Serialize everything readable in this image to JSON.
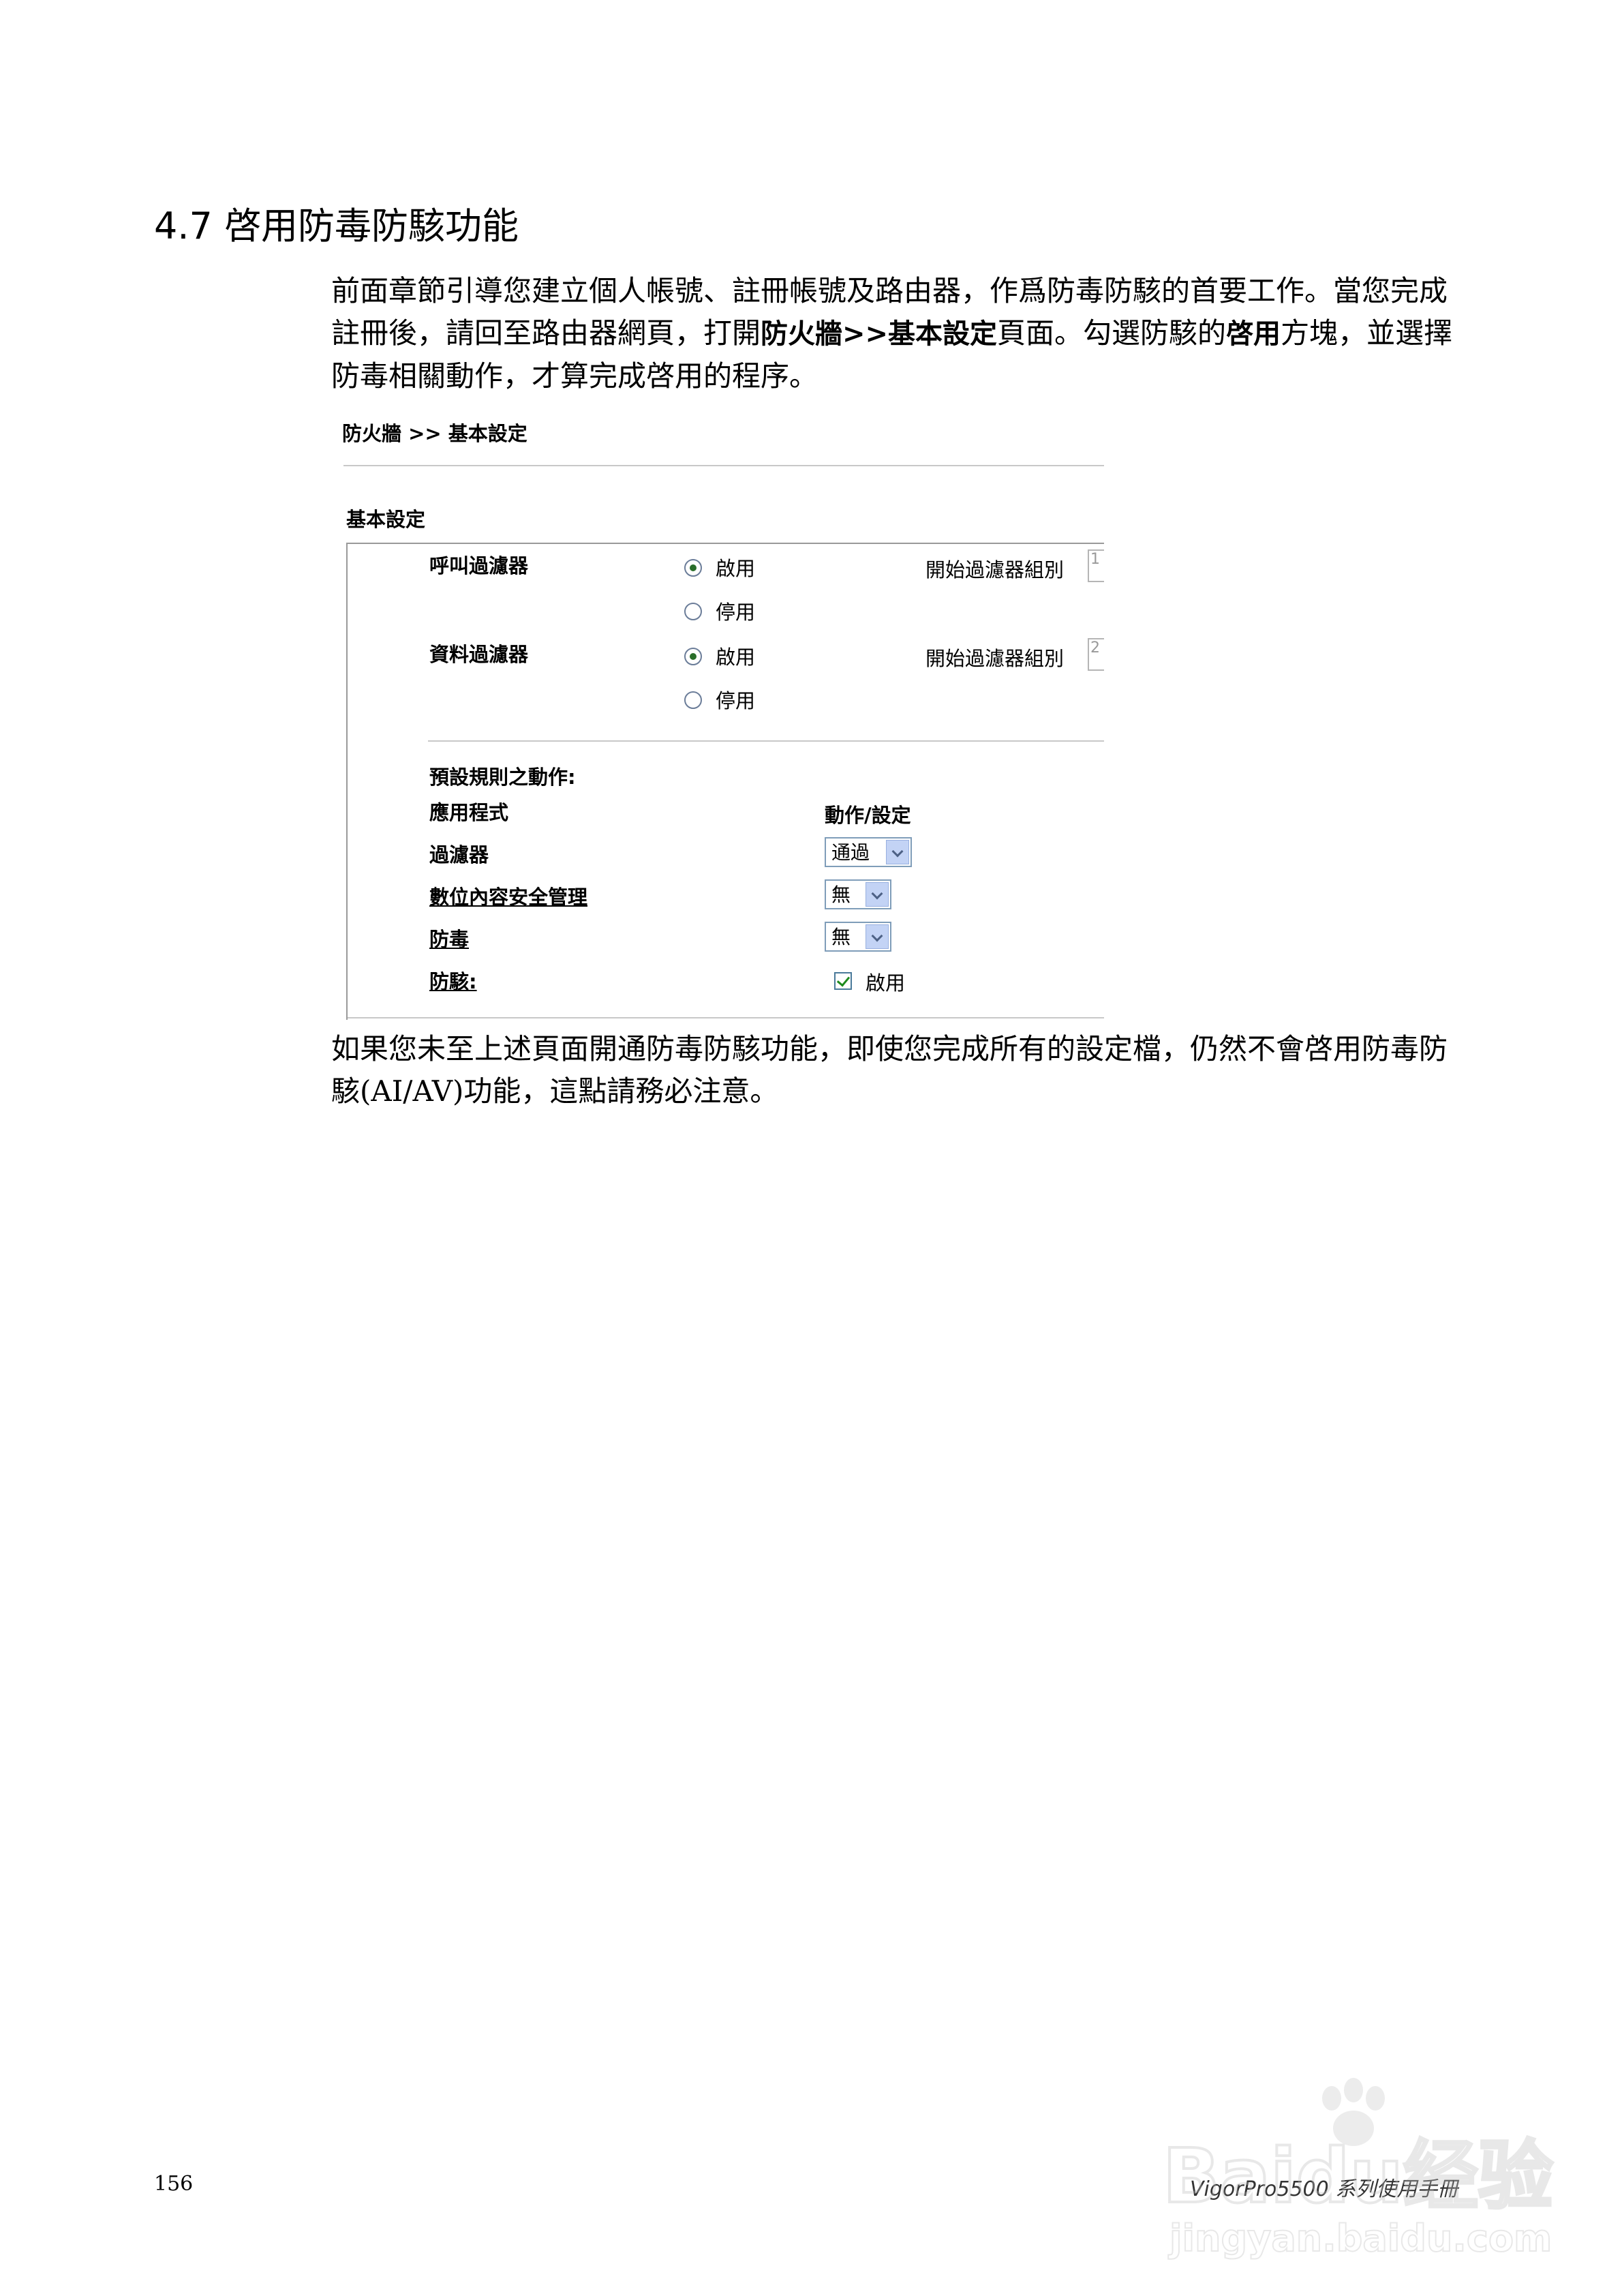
{
  "section": {
    "number": "4.7",
    "title": "啓用防毒防駭功能"
  },
  "intro": {
    "part1": "前面章節引導您建立個人帳號、註冊帳號及路由器，作爲防毒防駭的首要工作。當您完成註冊後，請回至路由器網頁，打開",
    "bold1": "防火牆>>基本設定",
    "part2": "頁面。勾選防駭的",
    "bold2": "啓用",
    "part3": "方塊，並選擇防毒相關動作，才算完成啓用的程序。"
  },
  "figure": {
    "breadcrumb": "防火牆 >> 基本設定",
    "panel_title": "基本設定",
    "call_filter": {
      "label": "呼叫過濾器",
      "enable": "啟用",
      "disable": "停用",
      "start_group_label": "開始過濾器組別",
      "selected": "enable"
    },
    "data_filter": {
      "label": "資料過濾器",
      "enable": "啟用",
      "disable": "停用",
      "start_group_label": "開始過濾器組別",
      "selected": "enable"
    },
    "default_rule_title": "預設規則之動作:",
    "col_application": "應用程式",
    "col_action": "動作/設定",
    "rows": [
      {
        "label": "過濾器",
        "value": "通過",
        "underlined": false
      },
      {
        "label": "數位內容安全管理",
        "value": "無",
        "underlined": true
      },
      {
        "label": "防毒",
        "value": "無",
        "underlined": true
      }
    ],
    "anti_intrusion": {
      "label": "防駭:",
      "checkbox_label": "啟用",
      "checked": true
    }
  },
  "outro": "如果您未至上述頁面開通防毒防駭功能，即使您完成所有的設定檔，仍然不會啓用防毒防駭(AI/AV)功能，這點請務必注意。",
  "footer": {
    "page_number": "156",
    "manual_title": "VigorPro5500 系列使用手冊"
  },
  "watermark": {
    "text_main": "Baidu经验",
    "text_url": "jingyan.baidu.com"
  }
}
